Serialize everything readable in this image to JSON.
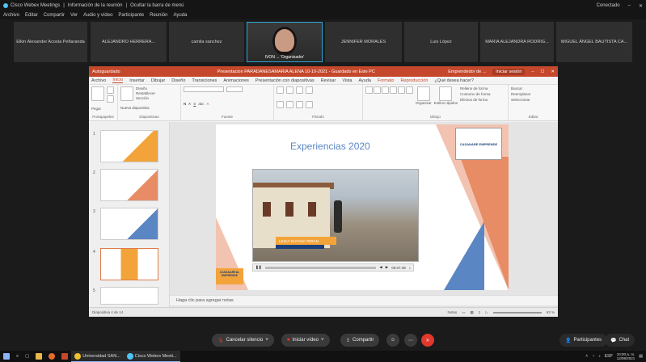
{
  "window": {
    "title": "Cisco Webex Meetings",
    "info_link": "Información de la reunión",
    "hide_bar": "Ocultar la barra de menú",
    "right_label": "Conectado",
    "min_icon": "minimize-icon",
    "close_icon": "close-icon"
  },
  "menu": [
    "Archivo",
    "Editar",
    "Compartir",
    "Ver",
    "Audio y vídeo",
    "Participante",
    "Reunión",
    "Ayuda"
  ],
  "participants": [
    "Elkin Alexander Acosta Peñaranda",
    "ALEJANDRO HERRERA...",
    "camila sanchez",
    "IVON ... 'Organizador'",
    "JENNIFER MORALES",
    "Luis López",
    "MARIA ALEJANDRA RODRIG...",
    "MIGUEL ÁNGEL BAUTISTA CA..."
  ],
  "ppt": {
    "autosave": "Autoguardado",
    "doc_title": "Presentacion PARADANESAMARIA ALENA 10-10-2021 - Guardado en Este PC",
    "user": "Emprendedor de ...",
    "share": "Iniciar sesión",
    "tabs": [
      "Archivo",
      "Inicio",
      "Insertar",
      "Dibujar",
      "Diseño",
      "Transiciones",
      "Animaciones",
      "Presentación con diapositivas",
      "Revisar",
      "Vista",
      "Ayuda",
      "Formato",
      "Reproducción",
      "¿Qué desea hacer?"
    ],
    "selected_tab": "Inicio",
    "groups": [
      "Portapapeles",
      "Diapositivas",
      "Fuente",
      "Párrafo",
      "Dibujo",
      "Editar"
    ],
    "ribbon_items": {
      "paste": "Pegar",
      "new_slide": "Nueva diapositiva",
      "design": "Diseño",
      "reset": "Restablecer",
      "section": "Sección",
      "organize": "Organizar",
      "quick_styles": "Estilos rápidos",
      "fill": "Relleno de forma",
      "outline": "Contorno de forma",
      "effects": "Efectos de forma",
      "find": "Buscar",
      "replace": "Reemplazar",
      "select": "Seleccionar"
    },
    "thumb_numbers": [
      "1",
      "2",
      "3",
      "4",
      "5"
    ],
    "slide_title": "Experiencias 2020",
    "logo_text": "CASANARE EMPRENDE",
    "video_banner": "LESLY DAYANA TERAN",
    "video_time": "00:07:48",
    "mini_logo": "CASANAREAL EMPRENDE",
    "notes_placeholder": "Haga clic para agregar notas",
    "slide_status": "Diapositiva 4 de 14",
    "status_notes": "Notas",
    "zoom": "63 %"
  },
  "controls": {
    "mute": "Cancelar silencio",
    "video": "Iniciar vídeo",
    "share": "Compartir",
    "participants": "Participantes",
    "chat": "Chat"
  },
  "taskbar": {
    "browser_tab": "Universidad SAN...",
    "webex_tab": "Cisco Webex Meeti...",
    "lang": "ESP",
    "time": "10:00 a. m.",
    "date": "12/08/2021"
  }
}
